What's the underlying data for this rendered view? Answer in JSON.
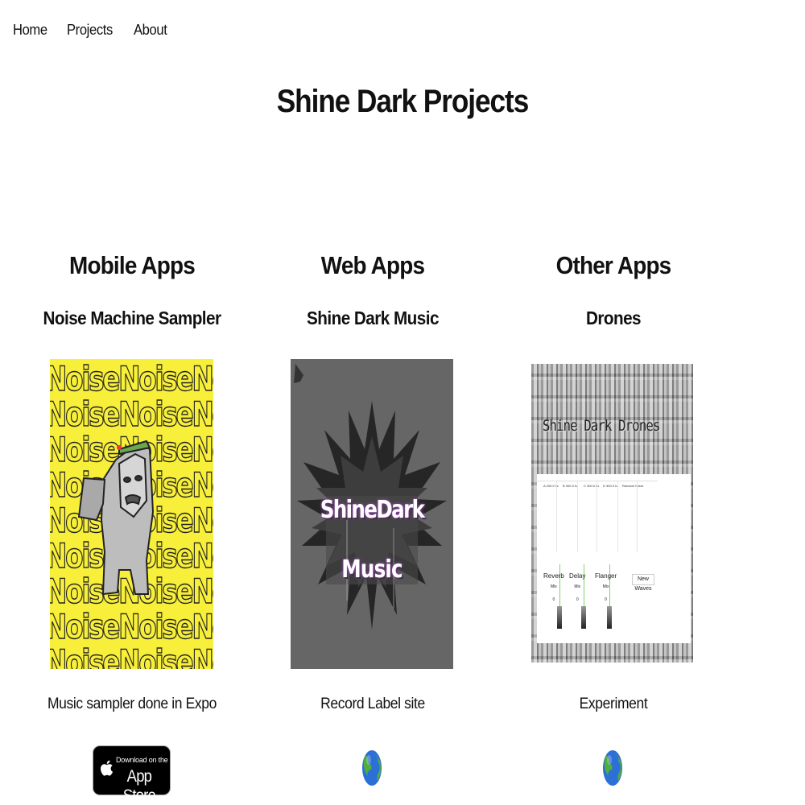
{
  "nav": {
    "items": [
      "Home",
      "Projects",
      "About"
    ]
  },
  "page": {
    "title": "Shine Dark Projects"
  },
  "columns": [
    {
      "category": "Mobile Apps",
      "project": "Noise Machine Sampler",
      "description": "Music sampler done in Expo",
      "thumbnail": {
        "pattern_text": "NoiseNoiseNoise"
      },
      "badge": {
        "small": "Download on the",
        "big": "App Store"
      }
    },
    {
      "category": "Web Apps",
      "project": "Shine Dark Music",
      "description": "Record Label site",
      "thumbnail": {
        "logo_line1": "ShineDark",
        "logo_line2": "Music"
      },
      "link_icon": "globe-icon"
    },
    {
      "category": "Other Apps",
      "project": "Drones",
      "description": "Experiment",
      "thumbnail": {
        "title": "Shine Dark Drones",
        "headers": [
          "A 200.0 hz",
          "B 300.0 hz",
          "C 300.0 hz",
          "D 300.0 hz",
          "Random Noise"
        ],
        "controls": [
          {
            "label": "Reverb",
            "sub": "Mix",
            "value": "0"
          },
          {
            "label": "Delay",
            "sub": "Mix",
            "value": "0"
          },
          {
            "label": "Flanger",
            "sub": "Mix",
            "value": "0"
          }
        ],
        "button": "New Waves"
      },
      "link_icon": "globe-icon"
    }
  ],
  "colors": {
    "noise_yellow": "#f7ef3a",
    "music_gray": "#666666",
    "text": "#111111"
  }
}
